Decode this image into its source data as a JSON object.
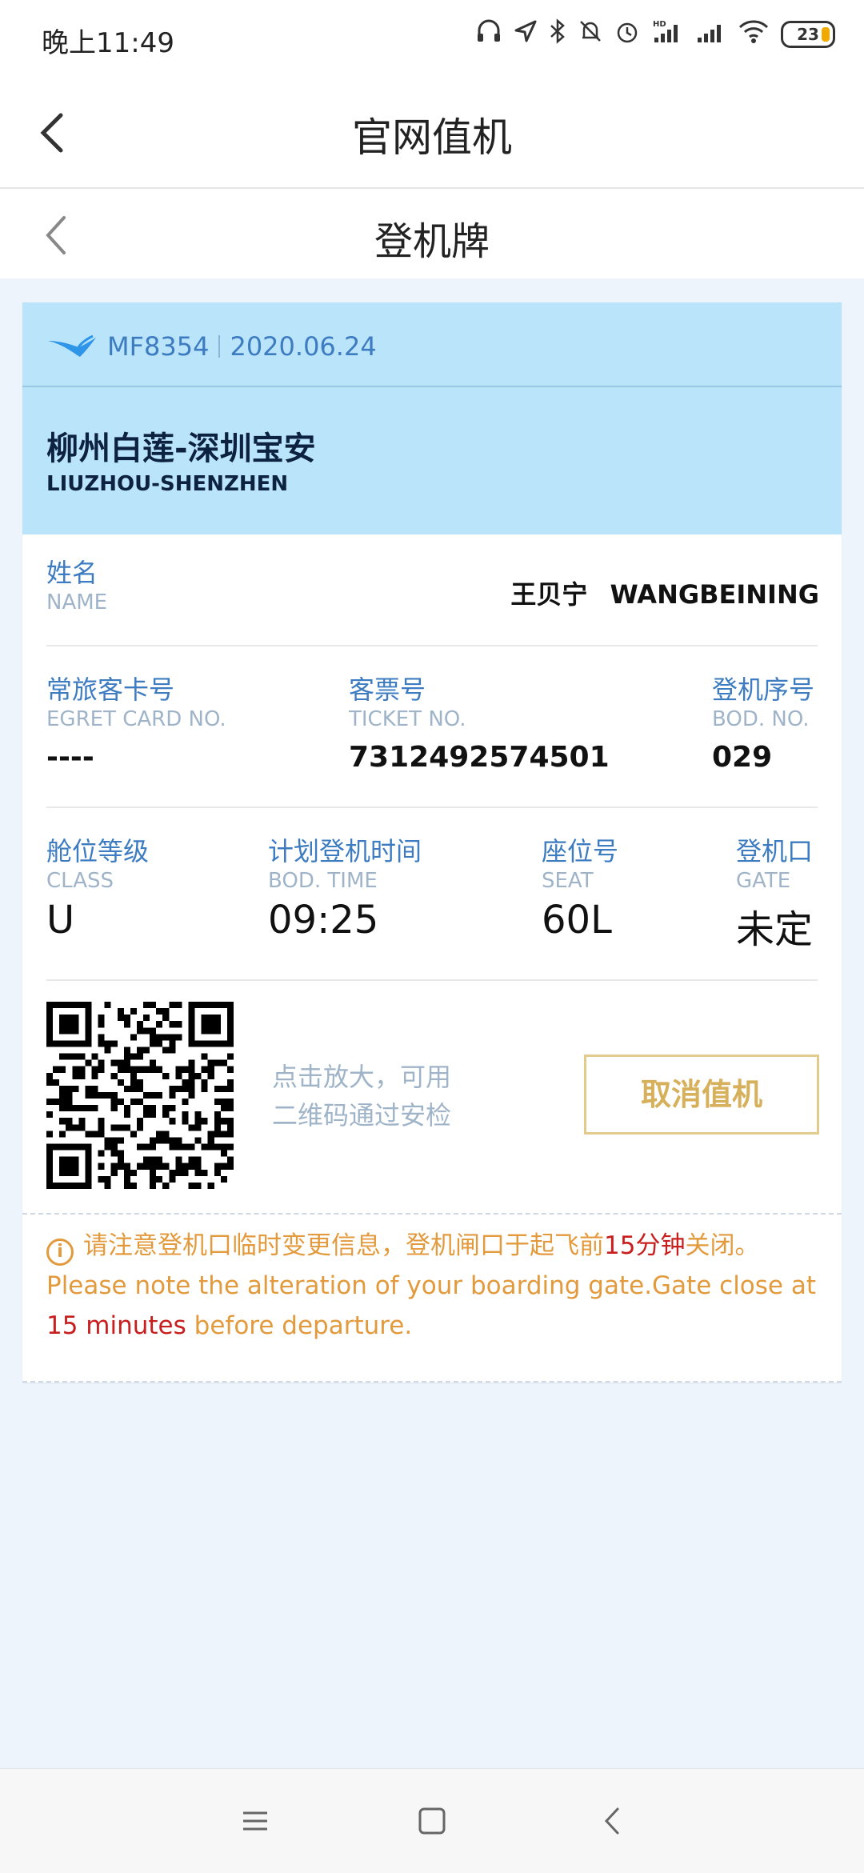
{
  "status": {
    "time": "晚上11:49",
    "battery": "23",
    "hd": "HD"
  },
  "header": {
    "title": "官网值机"
  },
  "subheader": {
    "title": "登机牌"
  },
  "flight": {
    "number": "MF8354",
    "date": "2020.06.24"
  },
  "route": {
    "cn": "柳州白莲-深圳宝安",
    "en": "LIUZHOU-SHENZHEN"
  },
  "passenger": {
    "label_cn": "姓名",
    "label_en": "NAME",
    "name_cn": "王贝宁",
    "name_en": "WANGBEINING"
  },
  "details_row1": [
    {
      "label_cn": "常旅客卡号",
      "label_en": "EGRET CARD NO.",
      "value": "----"
    },
    {
      "label_cn": "客票号",
      "label_en": "TICKET NO.",
      "value": "7312492574501"
    },
    {
      "label_cn": "登机序号",
      "label_en": "BOD. NO.",
      "value": "029"
    }
  ],
  "details_row2": [
    {
      "label_cn": "舱位等级",
      "label_en": "CLASS",
      "value": "U"
    },
    {
      "label_cn": "计划登机时间",
      "label_en": "BOD. TIME",
      "value": "09:25"
    },
    {
      "label_cn": "座位号",
      "label_en": "SEAT",
      "value": "60L"
    },
    {
      "label_cn": "登机口",
      "label_en": "GATE",
      "value": "未定"
    }
  ],
  "qr": {
    "hint_line1": "点击放大，可用",
    "hint_line2": "二维码通过安检"
  },
  "actions": {
    "cancel_checkin": "取消值机"
  },
  "notice": {
    "cn_part1": "请注意登机口临时变更信息，登机闸口于起飞前",
    "cn_highlight": "15分钟",
    "cn_part2": "关闭。",
    "en_part1": "Please note the alteration of your boarding gate.Gate close at ",
    "en_highlight": "15 minutes",
    "en_part2": " before departure."
  },
  "colors": {
    "accent": "#3d7cc1",
    "header_band": "#b9e4fa",
    "warning": "#e39a3c",
    "highlight": "#c81e1e",
    "button_border": "#e2cb8c"
  }
}
